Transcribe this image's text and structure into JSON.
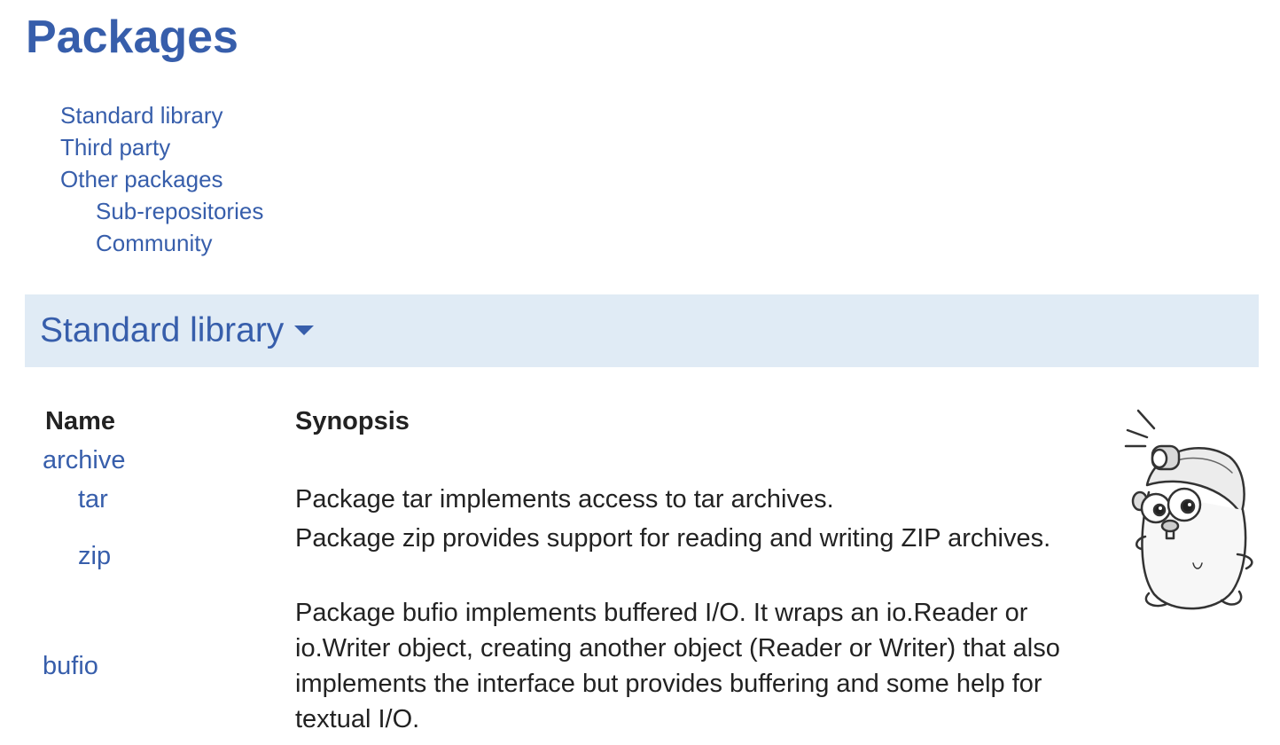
{
  "page": {
    "title": "Packages"
  },
  "toc": {
    "standard_library": "Standard library",
    "third_party": "Third party",
    "other_packages": "Other packages",
    "sub_repositories": "Sub-repositories",
    "community": "Community"
  },
  "section": {
    "title": "Standard library",
    "icon": "caret-down-icon"
  },
  "table": {
    "headers": {
      "name": "Name",
      "synopsis": "Synopsis"
    },
    "rows": [
      {
        "name": "archive",
        "synopsis": ""
      },
      {
        "name": "tar",
        "synopsis": "Package tar implements access to tar archives."
      },
      {
        "name": "zip",
        "synopsis": "Package zip provides support for reading and writing ZIP archives."
      },
      {
        "name": "bufio",
        "synopsis": "Package bufio implements buffered I/O. It wraps an io.Reader or io.Writer object, creating another object (Reader or Writer) that also implements the interface but provides buffering and some help for textual I/O."
      }
    ]
  },
  "illustration": {
    "icon": "gopher-miner-icon"
  },
  "colors": {
    "link": "#375eab",
    "section_bg": "#e0ebf5",
    "text": "#222222"
  }
}
